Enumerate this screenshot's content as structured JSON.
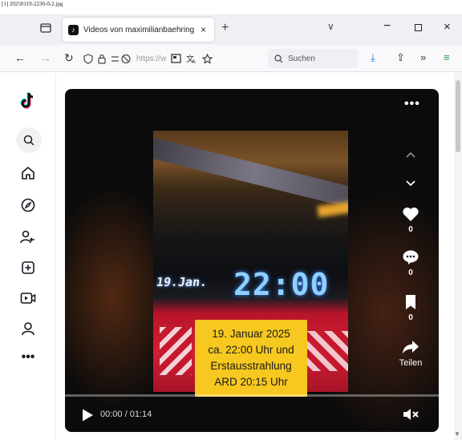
{
  "file_label": "[1] 20250119-2230-0-2.jpg",
  "browser": {
    "tab": {
      "title": "Videos von maximilianbaehring",
      "close": "×"
    },
    "new_tab": "+",
    "overflow": "∨",
    "window": {
      "minimize": "−",
      "close": "×"
    },
    "nav": {
      "back": "←",
      "forward": "→",
      "reload": "↻",
      "url_text": "https://w",
      "search_placeholder": "Suchen",
      "download": "⤓",
      "share": "⇪",
      "more": "»",
      "menu": "≡"
    }
  },
  "player": {
    "more": "•••",
    "caption_lines": [
      "19. Januar 2025",
      "ca. 22:00 Uhr und",
      "Erstausstrahlung",
      "ARD 20:15 Uhr"
    ],
    "frame_text": {
      "date": "19.Jan.",
      "time": "22:00"
    },
    "actions": {
      "like_count": "0",
      "comment_count": "0",
      "save_count": "0",
      "share_label": "Teilen"
    },
    "progress": 0.0,
    "time": "00:00 / 01:14"
  },
  "colors": {
    "caption": "#f7c81f",
    "accent": "#fe2c55",
    "player_bg": "#0b0b0b"
  }
}
